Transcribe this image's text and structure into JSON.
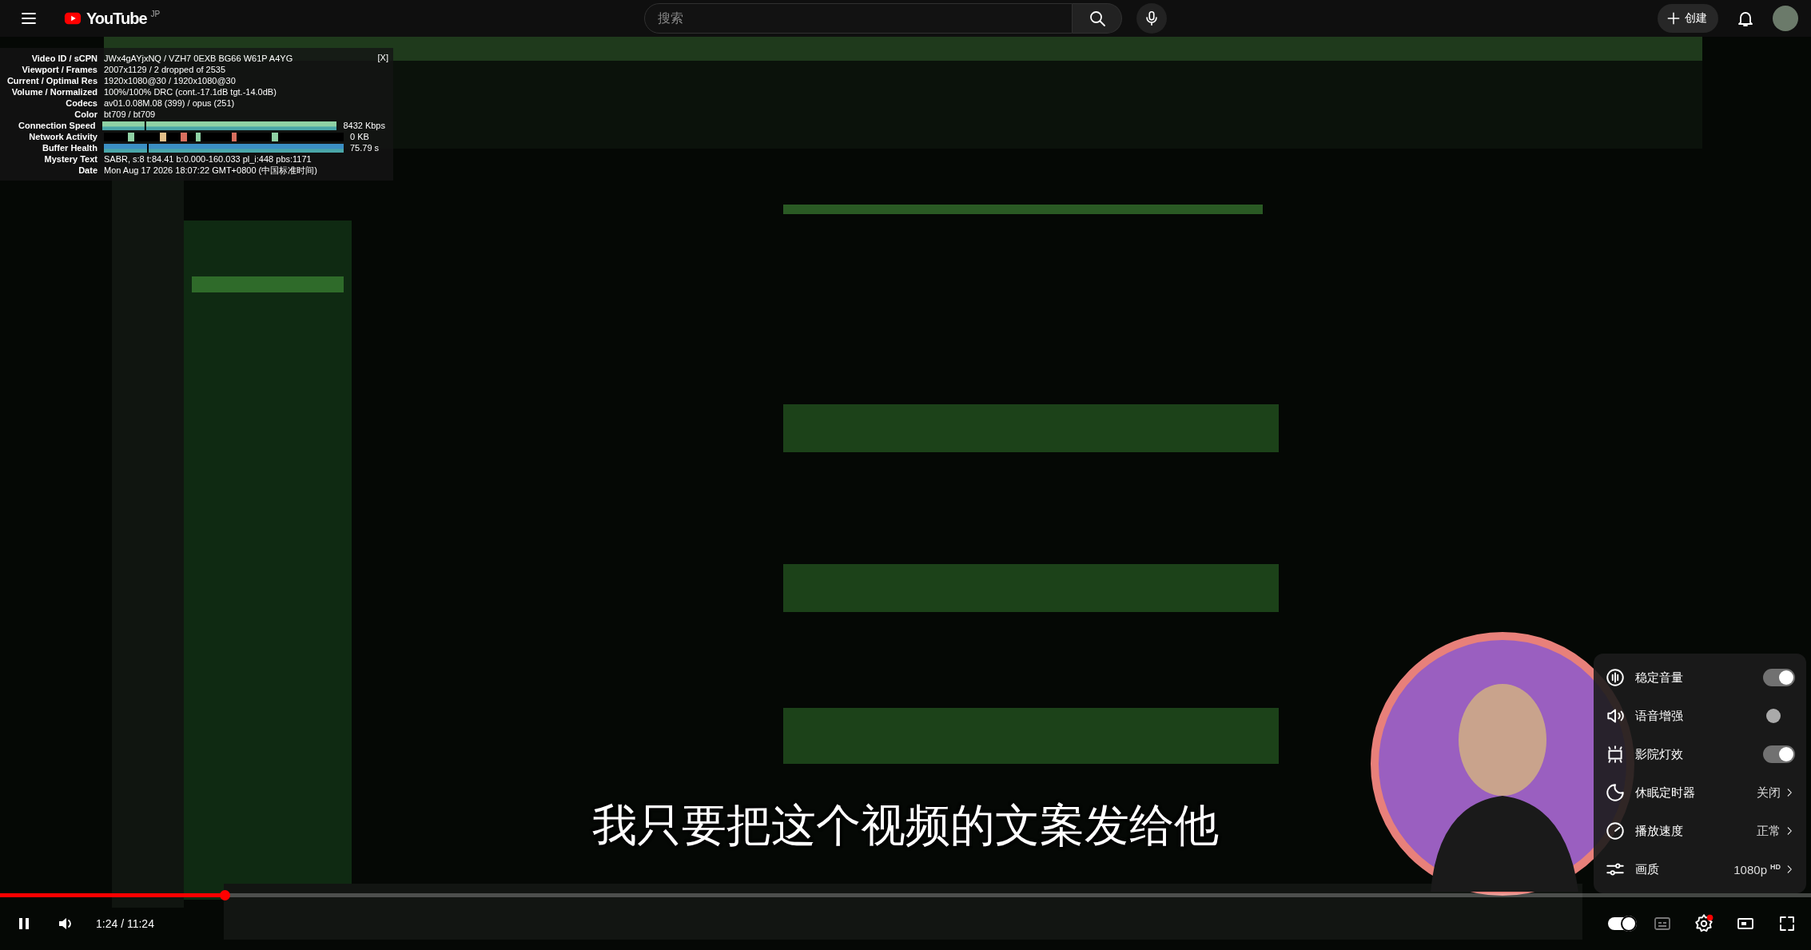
{
  "topbar": {
    "logo": {
      "text": "YouTube",
      "region": "JP"
    },
    "search": {
      "placeholder": "搜索"
    },
    "create_button": "创建"
  },
  "stats": {
    "close": "[X]",
    "rows": [
      {
        "kind": "text",
        "label": "Video ID / sCPN",
        "value": "JWx4gAYjxNQ / VZH7 0EXB BG66 W61P A4YG"
      },
      {
        "kind": "text",
        "label": "Viewport / Frames",
        "value": "2007x1129 / 2 dropped of 2535"
      },
      {
        "kind": "text",
        "label": "Current / Optimal Res",
        "value": "1920x1080@30 / 1920x1080@30"
      },
      {
        "kind": "text",
        "label": "Volume / Normalized",
        "value": "100%/100% DRC (cont.-17.1dB tgt.-14.0dB)"
      },
      {
        "kind": "text",
        "label": "Codecs",
        "value": "av01.0.08M.08 (399) / opus (251)"
      },
      {
        "kind": "text",
        "label": "Color",
        "value": "bt709 / bt709"
      },
      {
        "kind": "graph",
        "label": "Connection Speed",
        "reading": "8432 Kbps"
      },
      {
        "kind": "activity",
        "label": "Network Activity",
        "reading": "0 KB"
      },
      {
        "kind": "graph",
        "label": "Buffer Health",
        "reading": "75.79 s"
      },
      {
        "kind": "text",
        "label": "Mystery Text",
        "value": "SABR, s:8 t:84.41 b:0.000-160.033 pl_i:448 pbs:1171"
      },
      {
        "kind": "text",
        "label": "Date",
        "value": "Mon Aug 17 2026 18:07:22 GMT+0800 (中国标准时间)"
      }
    ]
  },
  "captions": {
    "text": "我只要把这个视频的文案发给他"
  },
  "settings_menu": {
    "items": [
      {
        "kind": "toggle",
        "label": "稳定音量",
        "on": true
      },
      {
        "kind": "toggle",
        "label": "语音增强",
        "on": false
      },
      {
        "kind": "toggle",
        "label": "影院灯效",
        "on": true
      },
      {
        "kind": "submenu",
        "label": "休眠定时器",
        "value": "关闭"
      },
      {
        "kind": "submenu",
        "label": "播放速度",
        "value": "正常"
      },
      {
        "kind": "submenu",
        "label": "画质",
        "value": "1080p",
        "badge": "HD"
      }
    ]
  },
  "player": {
    "progress": {
      "level": 0.124
    },
    "time": "1:24 / 11:24",
    "playing": true,
    "autoplay": {
      "on": true
    }
  }
}
